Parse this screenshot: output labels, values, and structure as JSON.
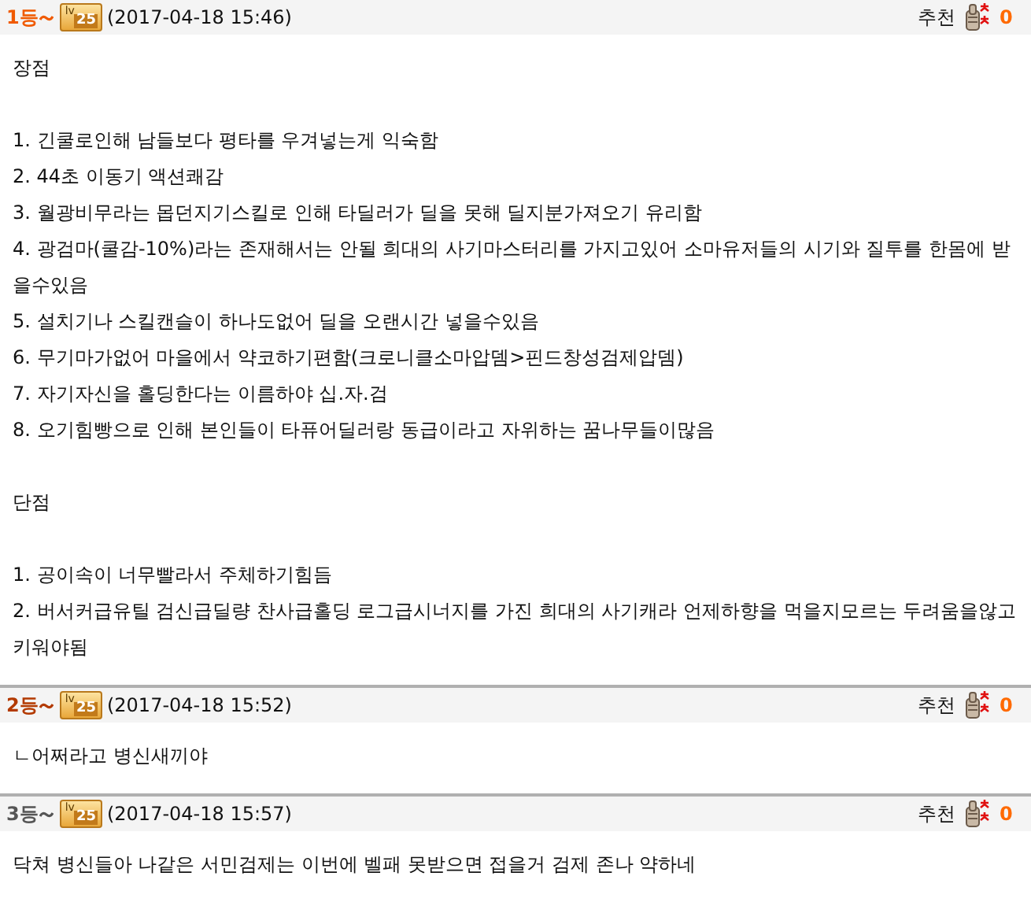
{
  "comments": [
    {
      "rank": "1등",
      "color": "#f05a00",
      "badge_prefix": "lv",
      "badge": "25",
      "time": "(2017-04-18 15:46)",
      "recommend_label": "추천",
      "recommend_count": "0",
      "sections": [
        {
          "heading": "장점",
          "items": [
            "1. 긴쿨로인해 남들보다 평타를 우겨넣는게 익숙함",
            "2. 44초 이동기 액션쾌감",
            "3. 월광비무라는 몹던지기스킬로 인해 타딜러가 딜을 못해 딜지분가져오기 유리함",
            "4. 광검마(쿨감-10%)라는 존재해서는 안될 희대의 사기마스터리를 가지고있어 소마유저들의 시기와 질투를 한몸에 받을수있음",
            "5. 설치기나 스킬캔슬이 하나도없어 딜을 오랜시간 넣을수있음",
            "6. 무기마가없어 마을에서 약코하기편함(크로니클소마압뎀>핀드창성검제압뎀)",
            "7. 자기자신을 홀딩한다는 이름하야 십.자.검",
            "8. 오기힘빵으로 인해 본인들이 타퓨어딜러랑 동급이라고 자위하는 꿈나무들이많음"
          ]
        },
        {
          "heading": "단점",
          "items": [
            "1. 공이속이 너무빨라서 주체하기힘듬",
            "2. 버서커급유틸 검신급딜량 찬사급홀딩 로그급시너지를 가진 희대의 사기캐라 언제하향을 먹을지모르는 두려움을않고 키워야됨"
          ]
        }
      ]
    },
    {
      "rank": "2등",
      "color": "#b33a00",
      "badge_prefix": "lv",
      "badge": "25",
      "time": "(2017-04-18 15:52)",
      "recommend_label": "추천",
      "recommend_count": "0",
      "sections": [
        {
          "items": [
            "ㄴ어쩌라고 병신새끼야"
          ]
        }
      ]
    },
    {
      "rank": "3등",
      "color": "#555555",
      "badge_prefix": "lv",
      "badge": "25",
      "time": "(2017-04-18 15:57)",
      "recommend_label": "추천",
      "recommend_count": "0",
      "sections": [
        {
          "items": [
            "닥쳐 병신들아 나같은 서민검제는 이번에 벨패 못받으면 접을거 검제 존나 약하네"
          ]
        }
      ]
    }
  ]
}
